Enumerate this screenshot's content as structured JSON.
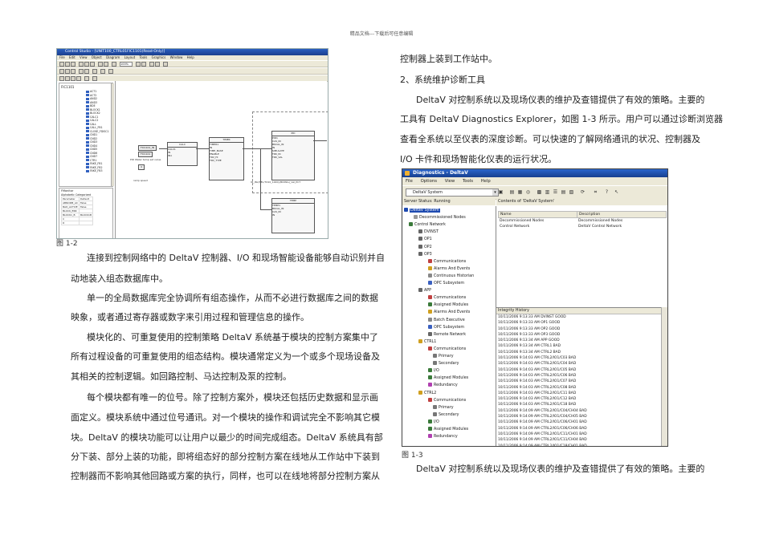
{
  "header": "精品文档---下载后可任意编辑",
  "right_intro": "控制器上装到工作站中。",
  "section_title": "2、系统维护诊断工具",
  "right_paras": [
    "DeltaV 对控制系统以及现场仪表的维护及查错提供了有效的策略。主要的",
    "工具有 DeltaV Diagnostics Explorer，如图 1-3 所示。用户可以通过诊断浏览器",
    "查看全系统以至仪表的深度诊断。可以快速的了解网络通讯的状况、控制器及",
    "I/O 卡件和现场智能化仪表的运行状况。"
  ],
  "fig12_caption": "图 1-2",
  "fig13_caption": "图 1-3",
  "bottom_right": "DeltaV 对控制系统以及现场仪表的维护及查错提供了有效的策略。主要的",
  "left_paras": [
    "连接到控制网络中的 DeltaV 控制器、I/O 和现场智能设备能够自动识别并自",
    "动地装入组态数据库中。",
    "单一的全局数据库完全协调所有组态操作，从而不必进行数据库之间的数据",
    "映象，或者通过寄存器或数字来引用过程和管理信息的操作。",
    "模块化的、可重复使用的控制策略 DeltaV 系统基于模块的控制方案集中了",
    "所有过程设备的可重复使用的组态结构。模块通常定义为一个或多个现场设备及",
    "其相关的控制逻辑。如回路控制、马达控制及泵的控制。",
    "每个模块都有唯一的位号。除了控制方案外，模块还包括历史数据和显示画",
    "面定义。模块系统中通过位号通讯。对一个模块的操作和调试完全不影响其它模",
    "块。DeltaV 的模块功能可以让用户以最少的时间完成组态。DeltaV 系统具有部",
    "分下装、部分上装的功能，即将组态好的部分控制方案在线地从工作站中下装到",
    "控制器而不影响其他回路或方案的执行，同样，也可以在线地将部分控制方案从"
  ],
  "control_studio": {
    "title": "Control Studio - [UNIT100_CTRL01FIC1101(Read-Only)]",
    "menu": [
      "File",
      "Edit",
      "View",
      "Object",
      "Diagram",
      "Layout",
      "Tools",
      "Graphics",
      "Window",
      "Help"
    ],
    "zoom": "100%",
    "tree_root": "FIC1101",
    "palette": [
      "ACT1",
      "ACT2",
      "AND2",
      "AND3",
      "BDE",
      "BLOCK1",
      "BLOCK2",
      "CALC1",
      "CALC2",
      "CALL",
      "CALL_FB1",
      "CLOSE_FDISC1",
      "CND1",
      "CND2",
      "CND3",
      "CND4",
      "CND5",
      "CND6",
      "CND7",
      "CTR1",
      "FAKE_FB1",
      "FAKE_FB2",
      "FAKE_FB3"
    ],
    "props_label": "FMonitor",
    "props_tabs": [
      "Alphabetic",
      "Categorized"
    ],
    "props_header": [
      "Parameter",
      "Default"
    ],
    "props_rows": [
      [
        "ABNORM_AC",
        "False"
      ],
      [
        "BAD_ACTIVE",
        "False"
      ],
      [
        "BLOCK_ERR",
        ""
      ],
      [
        "BLOCK1_B",
        "BLOCK1B"
      ],
      [
        "C",
        ""
      ],
      [
        "D",
        ""
      ]
    ],
    "blocks": {
      "calc": {
        "h1": "CALC",
        "h2": "CALC1",
        "lines": [
          "IN",
          "IN1",
          "IN2"
        ]
      },
      "timer": {
        "h1": "TIMER",
        "h2": "TIMER1",
        "lines": [
          "IN",
          "OUT",
          "TIME_BASE",
          "CUR_MIN",
          "ENABLE",
          "TRV_HI",
          "TRV_LO",
          "TRV_TYPE"
        ]
      },
      "pid": {
        "h1": "PID",
        "h2": "PID1",
        "lines": [
          "CAS_IN",
          "BKCAL_IN",
          "FRCC_IN",
          "IN",
          "SIMULATE",
          "TRK_IN",
          "TRK_VAL"
        ]
      },
      "ai": {
        "h1": "TEMP",
        "h2": "TEMP1",
        "lines": [
          "BKCAL_IN",
          "CAS_IN",
          "IN"
        ]
      }
    },
    "tags": [
      "FIC1101_IN",
      "FIC1101",
      "4"
    ],
    "note_ramp": "PID Water temp set value",
    "note_speed": "ramp speed",
    "note_out": "IO_INx(TEL/TO10_1000)(MIXING)_Val_PCT"
  },
  "diagnostics": {
    "title": "Diagnostics - DeltaV",
    "menu": [
      "File",
      "Options",
      "View",
      "Tools",
      "Help"
    ],
    "combo": "DeltaV System",
    "status": "Server Status: Running",
    "contents_label": "Contents of 'DeltaV System'",
    "tree": [
      {
        "t": "DeltaV System",
        "x": 2,
        "c": "#1d4ab0",
        "sel": true
      },
      {
        "t": "Decommissioned Nodes",
        "x": 14,
        "c": "#999"
      },
      {
        "t": "Control Network",
        "x": 8,
        "c": "#3a7a3a"
      },
      {
        "t": "DVINST",
        "x": 20,
        "c": "#666"
      },
      {
        "t": "OP1",
        "x": 20,
        "c": "#666"
      },
      {
        "t": "OP2",
        "x": 20,
        "c": "#666"
      },
      {
        "t": "OP3",
        "x": 20,
        "c": "#666"
      },
      {
        "t": "Communications",
        "x": 32,
        "c": "#c04040"
      },
      {
        "t": "Alarms And Events",
        "x": 32,
        "c": "#d0a020"
      },
      {
        "t": "Continuous Historian",
        "x": 32,
        "c": "#888"
      },
      {
        "t": "OPC Subsystem",
        "x": 32,
        "c": "#3a60c0"
      },
      {
        "t": "APP",
        "x": 20,
        "c": "#666"
      },
      {
        "t": "Communications",
        "x": 32,
        "c": "#c04040"
      },
      {
        "t": "Assigned Modules",
        "x": 32,
        "c": "#3a7a3a"
      },
      {
        "t": "Alarms And Events",
        "x": 32,
        "c": "#d0a020"
      },
      {
        "t": "Batch Executive",
        "x": 32,
        "c": "#888"
      },
      {
        "t": "OPC Subsystem",
        "x": 32,
        "c": "#3a60c0"
      },
      {
        "t": "Remote Network",
        "x": 32,
        "c": "#666"
      },
      {
        "t": "CTRL1",
        "x": 20,
        "c": "#d0a020"
      },
      {
        "t": "Communications",
        "x": 32,
        "c": "#c04040"
      },
      {
        "t": "Primary",
        "x": 38,
        "c": "#777"
      },
      {
        "t": "Secondary",
        "x": 38,
        "c": "#777"
      },
      {
        "t": "I/O",
        "x": 32,
        "c": "#3a7a3a"
      },
      {
        "t": "Assigned Modules",
        "x": 32,
        "c": "#3a7a3a"
      },
      {
        "t": "Redundancy",
        "x": 32,
        "c": "#b040b0"
      },
      {
        "t": "CTRL2",
        "x": 20,
        "c": "#d0a020"
      },
      {
        "t": "Communications",
        "x": 32,
        "c": "#c04040"
      },
      {
        "t": "Primary",
        "x": 38,
        "c": "#777"
      },
      {
        "t": "Secondary",
        "x": 38,
        "c": "#777"
      },
      {
        "t": "I/O",
        "x": 32,
        "c": "#3a7a3a"
      },
      {
        "t": "Assigned Modules",
        "x": 32,
        "c": "#3a7a3a"
      },
      {
        "t": "Redundancy",
        "x": 32,
        "c": "#b040b0"
      }
    ],
    "list_headers": [
      "Name",
      "Description"
    ],
    "list_rows": [
      [
        "Decommissioned Nodes",
        "Decommissioned Nodes"
      ],
      [
        "Control Network",
        "DeltaV Control Network"
      ]
    ],
    "history_title": "Integrity History",
    "history": [
      "10/11/2006 9:13:33 AM  DVINST  GOOD",
      "10/11/2006 9:13:33 AM  OP1  GOOD",
      "10/11/2006 9:13:33 AM  OP2  GOOD",
      "10/11/2006 9:13:33 AM  OP3  GOOD",
      "10/11/2006 9:13:34 AM  APP  GOOD",
      "10/11/2006 9:13:34 AM  CTRL1  BAD",
      "10/11/2006 9:13:34 AM  CTRL2  BAD",
      "10/11/2006 9:14:03 AM  CTRL2/IO1/C03  BAD",
      "10/11/2006 9:14:03 AM  CTRL2/IO1/C04  BAD",
      "10/11/2006 9:14:03 AM  CTRL2/IO1/C05  BAD",
      "10/11/2006 9:14:03 AM  CTRL2/IO1/C06  BAD",
      "10/11/2006 9:14:03 AM  CTRL2/IO1/C07  BAD",
      "10/11/2006 9:14:03 AM  CTRL2/IO1/C08  BAD",
      "10/11/2006 9:14:03 AM  CTRL2/IO1/C11  BAD",
      "10/11/2006 9:14:03 AM  CTRL2/IO1/C12  BAD",
      "10/11/2006 9:14:03 AM  CTRL2/IO1/C18  BAD",
      "10/11/2006 9:14:09 AM  CTRL2/IO1/C04/CH04  BAD",
      "10/11/2006 9:14:09 AM  CTRL2/IO1/C04/CH05  BAD",
      "10/11/2006 9:14:09 AM  CTRL2/IO1/C06/CH01  BAD",
      "10/11/2006 9:14:09 AM  CTRL2/IO1/C06/CH06  BAD",
      "10/11/2006 9:14:09 AM  CTRL2/IO1/C11/CH01  BAD",
      "10/11/2006 9:14:09 AM  CTRL2/IO1/C11/CH04  BAD",
      "10/11/2006 9:14:09 AM  CTRL2/IO1/C18/CH01  BAD"
    ]
  }
}
